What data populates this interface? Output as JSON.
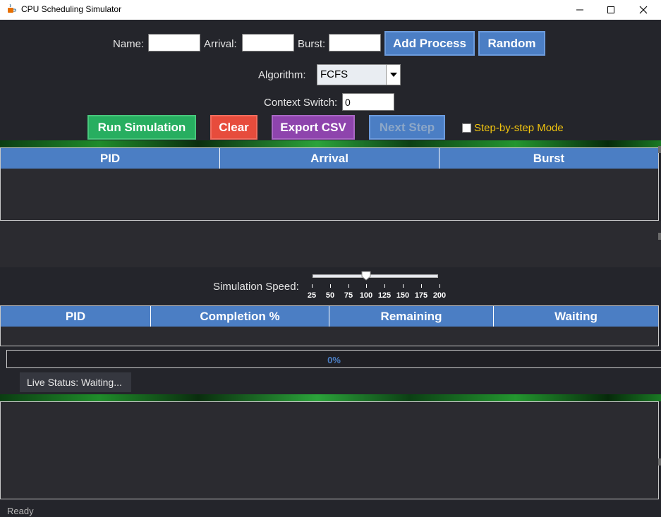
{
  "window": {
    "title": "CPU Scheduling Simulator"
  },
  "form": {
    "name_label": "Name:",
    "name_value": "",
    "arrival_label": "Arrival:",
    "arrival_value": "",
    "burst_label": "Burst:",
    "burst_value": "",
    "add_process_label": "Add Process",
    "random_label": "Random",
    "algorithm_label": "Algorithm:",
    "algorithm_selected": "FCFS",
    "context_switch_label": "Context Switch:",
    "context_switch_value": "0"
  },
  "actions": {
    "run_label": "Run Simulation",
    "clear_label": "Clear",
    "export_label": "Export CSV",
    "next_step_label": "Next Step",
    "step_mode_label": "Step-by-step Mode",
    "step_mode_checked": false
  },
  "process_table": {
    "columns": [
      "PID",
      "Arrival",
      "Burst"
    ],
    "rows": []
  },
  "speed": {
    "label": "Simulation Speed:",
    "ticks": [
      "25",
      "50",
      "75",
      "100",
      "125",
      "150",
      "175",
      "200"
    ],
    "value": 100
  },
  "results_table": {
    "columns": [
      "PID",
      "Completion %",
      "Remaining",
      "Waiting"
    ],
    "rows": []
  },
  "progress": {
    "text": "0%",
    "value": 0
  },
  "live_status": "Live Status: Waiting...",
  "status_bar": "Ready",
  "colors": {
    "background": "#24252b",
    "accent_blue": "#4b7ec4",
    "run_green": "#27ae60",
    "clear_red": "#e74c3c",
    "export_purple": "#8e44ad",
    "step_mode_yellow": "#f1c40f"
  },
  "icons": {
    "app": "java-cup-icon",
    "minimize": "minimize-icon",
    "maximize": "maximize-icon",
    "close": "close-icon",
    "dropdown": "chevron-down-icon"
  }
}
